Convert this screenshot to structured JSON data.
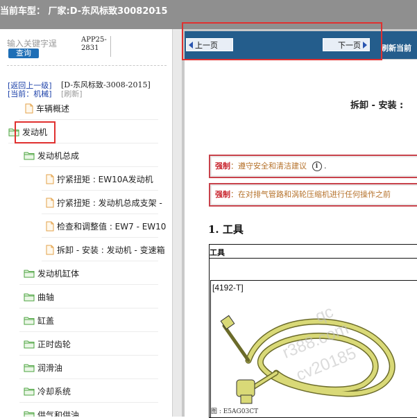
{
  "header": {
    "title": "当前车型：  厂家:D-东风标致30082015",
    "dot": "."
  },
  "search": {
    "placeholder": "输入关键字逞",
    "button": "查询",
    "app_code": "APP25-\n2831"
  },
  "nav": {
    "back": "[返回上一级]",
    "path": "[D-东风标致-3008-2015]",
    "current": "[当前：机械]",
    "refresh": "[刷新]"
  },
  "tree": [
    {
      "label": "车辆概述",
      "type": "file"
    },
    {
      "label": "发动机",
      "type": "folder"
    },
    {
      "label": "发动机总成",
      "type": "folder"
    },
    {
      "label": "拧紧扭矩 : EW10A发动机",
      "type": "file"
    },
    {
      "label": "拧紧扭矩 : 发动机总成支架 -",
      "type": "file"
    },
    {
      "label": "检查和调整值 : EW7 - EW10",
      "type": "file"
    },
    {
      "label": "拆卸 - 安装 : 发动机 - 变速箱",
      "type": "file"
    },
    {
      "label": "发动机缸体",
      "type": "folder"
    },
    {
      "label": "曲轴",
      "type": "folder"
    },
    {
      "label": "缸盖",
      "type": "folder"
    },
    {
      "label": "正时齿轮",
      "type": "folder"
    },
    {
      "label": "润滑油",
      "type": "folder"
    },
    {
      "label": "冷却系统",
      "type": "folder"
    },
    {
      "label": "供气和供油",
      "type": "folder"
    }
  ],
  "doc_toolbar": {
    "prev": "上一页",
    "next": "下一页",
    "refresh": "刷新当前"
  },
  "document": {
    "heading": "拆卸 - 安装 : ",
    "warnings": [
      {
        "label": "强制",
        "text": "：遵守安全和清洁建议",
        "suffix": "."
      },
      {
        "label": "强制",
        "text": "：在对排气管路和涡轮压缩机进行任何操作之前"
      }
    ],
    "section": "1. 工具",
    "table_header": "工具",
    "tool_code": "[4192-T]",
    "caption": "图 : E5AG03CT",
    "info_icon": "i"
  },
  "watermarks": [
    "qc",
    "r388.com",
    "cv20185"
  ],
  "colors": {
    "topbar": "#8f8f8f",
    "doc_toolbar": "#245d8c",
    "highlight": "#e0302f",
    "link": "#1a3fa8",
    "query_button": "#1e6eb6",
    "warn_border": "#c8424b"
  }
}
